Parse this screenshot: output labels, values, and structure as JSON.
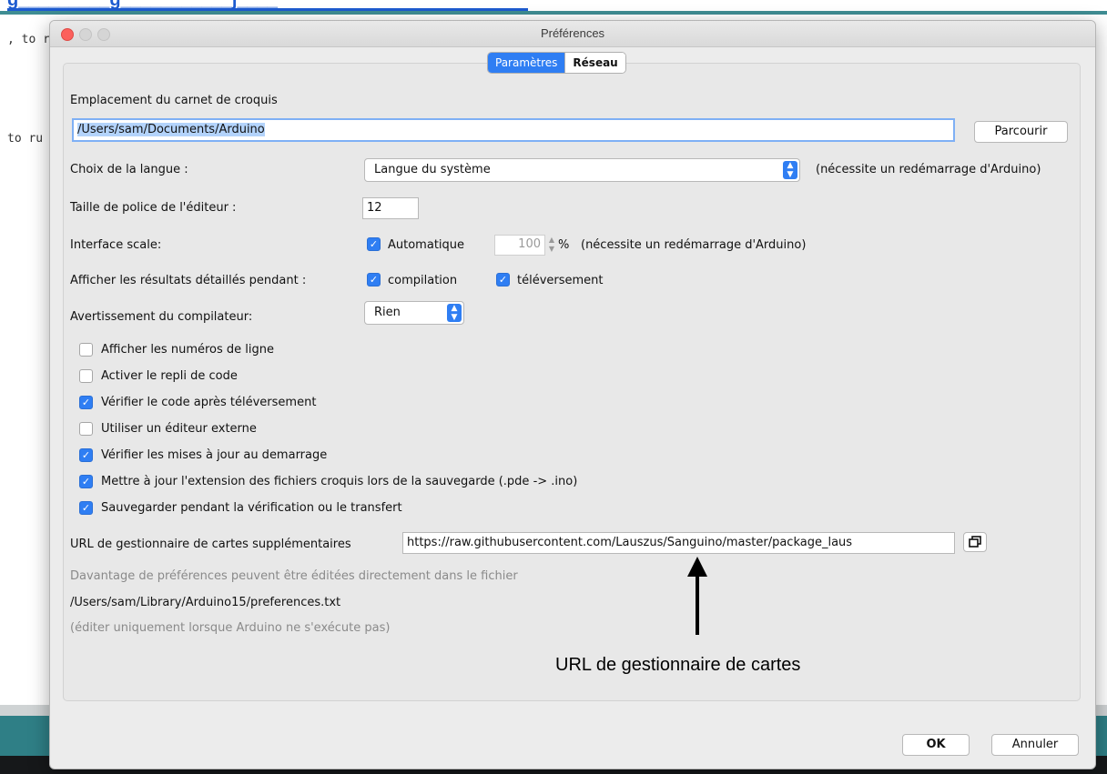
{
  "background": {
    "link_text": "g_________g___________j____",
    "code_lines": [
      ", to r",
      "to ru"
    ]
  },
  "dialog": {
    "title": "Préférences",
    "tabs": [
      {
        "label": "Paramètres",
        "active": true
      },
      {
        "label": "Réseau",
        "active": false
      }
    ],
    "sketchbook": {
      "label": "Emplacement du carnet de croquis",
      "value": "/Users/sam/Documents/Arduino",
      "browse_label": "Parcourir"
    },
    "language": {
      "label": "Choix de la langue :",
      "selected": "Langue du système",
      "note": "(nécessite un redémarrage d'Arduino)"
    },
    "font_size": {
      "label": "Taille de police de l'éditeur :",
      "value": "12"
    },
    "interface_scale": {
      "label": "Interface scale:",
      "auto_label": "Automatique",
      "auto_checked": true,
      "value": "100",
      "unit": "%",
      "note": "(nécessite un redémarrage d'Arduino)"
    },
    "verbose": {
      "label": "Afficher les résultats détaillés pendant :",
      "compilation_label": "compilation",
      "compilation_checked": true,
      "upload_label": "téléversement",
      "upload_checked": true
    },
    "warnings": {
      "label": "Avertissement du compilateur:",
      "selected": "Rien"
    },
    "options": [
      {
        "label": "Afficher les numéros de ligne",
        "checked": false
      },
      {
        "label": "Activer le repli de code",
        "checked": false
      },
      {
        "label": "Vérifier le code après téléversement",
        "checked": true
      },
      {
        "label": "Utiliser un éditeur externe",
        "checked": false
      },
      {
        "label": "Vérifier les mises à jour au demarrage",
        "checked": true
      },
      {
        "label": "Mettre à jour  l'extension des fichiers croquis lors de la sauvegarde (.pde -> .ino)",
        "checked": true
      },
      {
        "label": "Sauvegarder pendant la vérification ou le transfert",
        "checked": true
      }
    ],
    "board_urls": {
      "label": "URL de gestionnaire de cartes supplémentaires",
      "value": "https://raw.githubusercontent.com/Lauszus/Sanguino/master/package_laus"
    },
    "info": {
      "line1": "Davantage de préférences peuvent être éditées directement dans le fichier",
      "path": "/Users/sam/Library/Arduino15/preferences.txt",
      "line3": "(éditer uniquement lorsque Arduino ne s'exécute pas)"
    },
    "ok_label": "OK",
    "cancel_label": "Annuler"
  },
  "annotation": {
    "text": "URL de gestionnaire de cartes"
  },
  "colors": {
    "accent": "#2f7ef3",
    "teal": "#2f7f86"
  }
}
